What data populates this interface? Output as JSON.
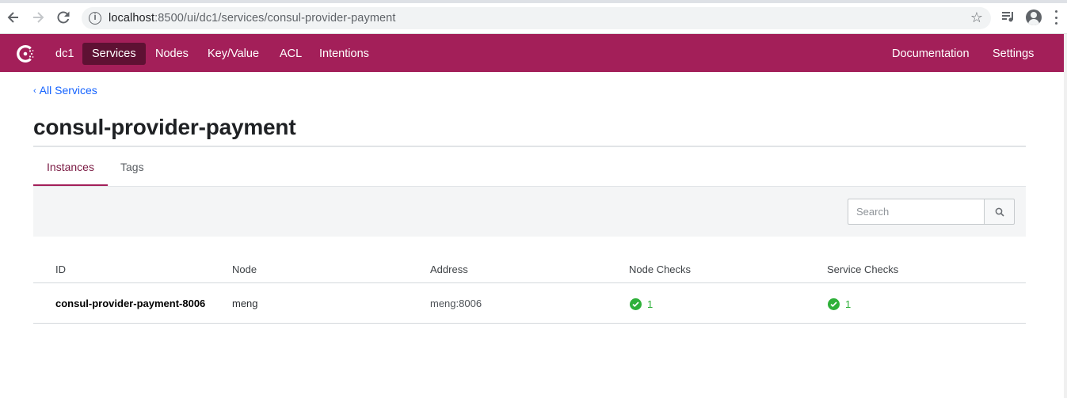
{
  "browser": {
    "url_host": "localhost",
    "url_rest": ":8500/ui/dc1/services/consul-provider-payment"
  },
  "topnav": {
    "datacenter": "dc1",
    "items": [
      "Services",
      "Nodes",
      "Key/Value",
      "ACL",
      "Intentions"
    ],
    "active": "Services",
    "right_items": [
      "Documentation",
      "Settings"
    ],
    "brand_color": "#a31f59"
  },
  "breadcrumb": {
    "label": "All Services"
  },
  "page": {
    "title": "consul-provider-payment"
  },
  "tabs": [
    {
      "label": "Instances",
      "selected": true
    },
    {
      "label": "Tags",
      "selected": false
    }
  ],
  "search": {
    "placeholder": "Search",
    "value": ""
  },
  "table": {
    "columns": [
      "ID",
      "Node",
      "Address",
      "Node Checks",
      "Service Checks"
    ],
    "rows": [
      {
        "id": "consul-provider-payment-8006",
        "node": "meng",
        "address": "meng:8006",
        "node_checks": "1",
        "service_checks": "1"
      }
    ]
  },
  "colors": {
    "passing": "#2eb039",
    "link": "#1563ff"
  }
}
